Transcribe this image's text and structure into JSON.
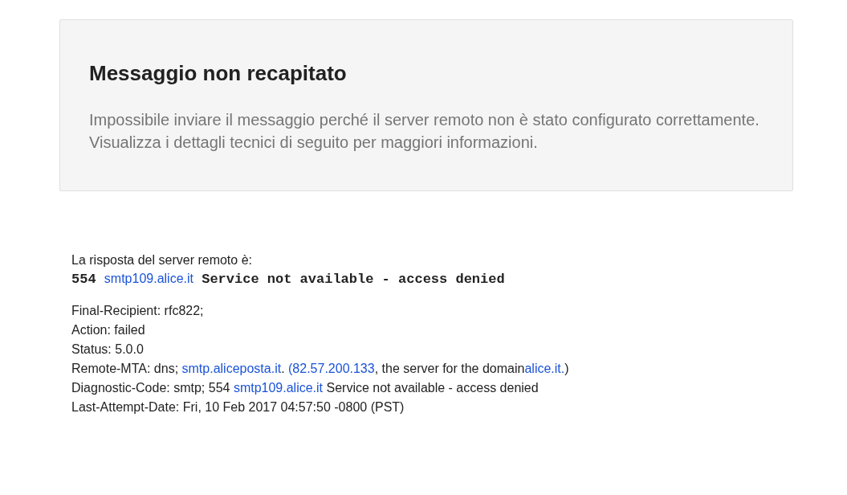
{
  "notice": {
    "title": "Messaggio non recapitato",
    "message": "Impossibile inviare il messaggio perché il server remoto non è stato configurato correttamente. Visualizza i dettagli tecnici di seguito per maggiori informazioni."
  },
  "response": {
    "label": "La risposta del server remoto è:",
    "segments": [
      {
        "kind": "mono",
        "text": "554 "
      },
      {
        "kind": "link",
        "text": "smtp109.alice.it"
      },
      {
        "kind": "mono",
        "text": " Service not available - access denied"
      }
    ]
  },
  "details": [
    {
      "segments": [
        {
          "kind": "text",
          "text": "Final-Recipient: rfc822;"
        }
      ]
    },
    {
      "segments": [
        {
          "kind": "text",
          "text": "Action: failed"
        }
      ]
    },
    {
      "segments": [
        {
          "kind": "text",
          "text": "Status: 5.0.0"
        }
      ]
    },
    {
      "segments": [
        {
          "kind": "text",
          "text": "Remote-MTA: dns; "
        },
        {
          "kind": "link",
          "text": "smtp.aliceposta.it"
        },
        {
          "kind": "text",
          "text": ". "
        },
        {
          "kind": "link",
          "text": "(82.57.200.133"
        },
        {
          "kind": "text",
          "text": ", the server for the domain"
        },
        {
          "kind": "link",
          "text": "alice.it."
        },
        {
          "kind": "text",
          "text": ")"
        }
      ]
    },
    {
      "segments": [
        {
          "kind": "text",
          "text": "Diagnostic-Code: smtp; 554 "
        },
        {
          "kind": "link",
          "text": "smtp109.alice.it"
        },
        {
          "kind": "text",
          "text": " Service not available - access denied"
        }
      ]
    },
    {
      "segments": [
        {
          "kind": "text",
          "text": "Last-Attempt-Date: Fri, 10 Feb 2017 04:57:50 -0800 (PST)"
        }
      ]
    }
  ]
}
